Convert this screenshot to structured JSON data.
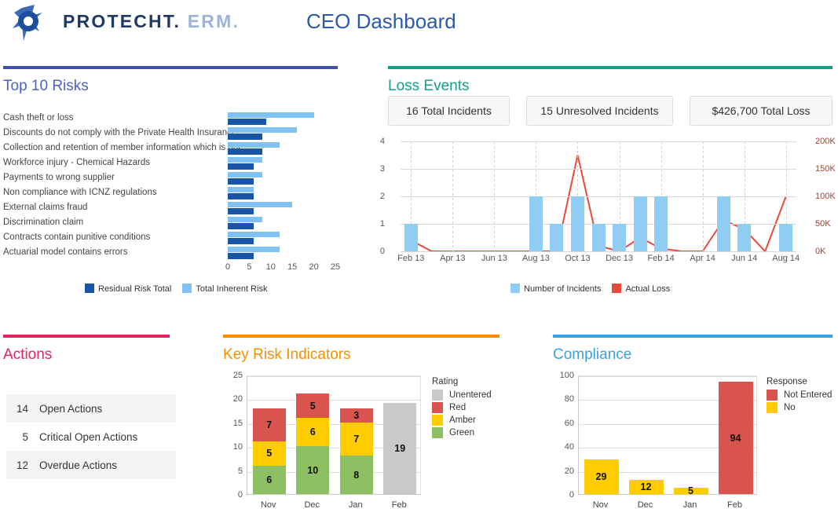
{
  "header": {
    "brand_primary": "PROTECHT.",
    "brand_secondary": "ERM.",
    "title": "CEO Dashboard",
    "logo_icon": "protecht-logo-icon"
  },
  "colors": {
    "risk_accent": "#3f51a8",
    "loss_accent": "#12a08a",
    "actions_accent": "#e0245e",
    "kri_accent": "#f59000",
    "compliance_accent": "#3aa0e0",
    "residual_risk": "#1a54a6",
    "inherent_risk": "#7ec1f2",
    "incidents_bar": "#8fcdf3",
    "actual_loss_line": "#e8493a",
    "rating_unentered": "#c9c9c9",
    "rating_red": "#d9534f",
    "rating_amber": "#ffcc00",
    "rating_green": "#8dc063"
  },
  "risks": {
    "title": "Top 10 Risks",
    "legend": [
      {
        "label": "Residual Risk Total",
        "color": "#1a54a6"
      },
      {
        "label": "Total Inherent Risk",
        "color": "#7ec1f2"
      }
    ],
    "chart_data": {
      "type": "bar",
      "orientation": "horizontal",
      "title": "Top 10 Risks",
      "xlabel": "",
      "ylabel": "",
      "xlim": [
        0,
        25
      ],
      "xticks": [
        0,
        5,
        10,
        15,
        20,
        25
      ],
      "grid": false,
      "legend_position": "bottom",
      "categories": [
        "Cash theft or loss",
        "Discounts do not comply with the Private Health Insurance",
        "Collection and retention of member information which is not",
        "Workforce injury - Chemical Hazards",
        "Payments to wrong supplier",
        "Non compliance with ICNZ regulations",
        "External claims fraud",
        "Discrimination claim",
        "Contracts contain punitive conditions",
        "Actuarial model contains errors"
      ],
      "series": [
        {
          "name": "Total Inherent Risk",
          "color": "#7ec1f2",
          "values": [
            20,
            16,
            12,
            8,
            8,
            6,
            15,
            8,
            12,
            12
          ]
        },
        {
          "name": "Residual Risk Total",
          "color": "#1a54a6",
          "values": [
            9,
            8,
            8,
            6,
            6,
            6,
            6,
            6,
            6,
            6
          ]
        }
      ]
    }
  },
  "loss": {
    "title": "Loss Events",
    "kpis": [
      {
        "label": "16 Total Incidents"
      },
      {
        "label": "15 Unresolved Incidents"
      },
      {
        "label": "$426,700 Total Loss"
      }
    ],
    "legend": [
      {
        "label": "Number of Incidents",
        "color": "#8fcdf3"
      },
      {
        "label": "Actual Loss",
        "color": "#e8493a"
      }
    ],
    "chart_data": {
      "type": "bar",
      "title": "Loss Events",
      "xlabel": "",
      "ylabel": "Number of Incidents",
      "y2label": "Actual Loss",
      "ylim": [
        0,
        4
      ],
      "yticks": [
        0,
        1,
        2,
        3,
        4
      ],
      "y2lim": [
        0,
        200000
      ],
      "y2ticks": [
        "0K",
        "50K",
        "100K",
        "150K",
        "200K"
      ],
      "grid": true,
      "legend_position": "bottom",
      "x": [
        "Feb 13",
        "Mar 13",
        "Apr 13",
        "May 13",
        "Jun 13",
        "Jul 13",
        "Aug 13",
        "Sep 13",
        "Oct 13",
        "Nov 13",
        "Dec 13",
        "Jan 14",
        "Feb 14",
        "Mar 14",
        "Apr 14",
        "May 14",
        "Jun 14",
        "Jul 14",
        "Aug 14"
      ],
      "xticks_shown": [
        "Feb 13",
        "Apr 13",
        "Jun 13",
        "Aug 13",
        "Oct 13",
        "Dec 13",
        "Feb 14",
        "Apr 14",
        "Jun 14",
        "Aug 14"
      ],
      "series": [
        {
          "name": "Number of Incidents",
          "type": "bar",
          "color": "#8fcdf3",
          "values": [
            1,
            0,
            0,
            0,
            0,
            0,
            2,
            1,
            2,
            1,
            1,
            2,
            2,
            0,
            0,
            2,
            1,
            0,
            1
          ]
        },
        {
          "name": "Actual Loss",
          "type": "line",
          "color": "#e8493a",
          "values": [
            20000,
            0,
            0,
            0,
            0,
            0,
            0,
            0,
            175000,
            10000,
            0,
            25000,
            5000,
            0,
            0,
            57000,
            40000,
            0,
            100000
          ]
        }
      ]
    }
  },
  "actions": {
    "title": "Actions",
    "items": [
      {
        "count": "14",
        "label": "Open Actions"
      },
      {
        "count": "5",
        "label": "Critical Open Actions"
      },
      {
        "count": "12",
        "label": "Overdue Actions"
      }
    ]
  },
  "kri": {
    "title": "Key Risk Indicators",
    "legend_title": "Rating",
    "chart_data": {
      "type": "bar",
      "stacked": true,
      "title": "Key Risk Indicators",
      "xlabel": "",
      "ylabel": "",
      "ylim": [
        0,
        25
      ],
      "yticks": [
        0,
        5,
        10,
        15,
        20,
        25
      ],
      "grid": true,
      "legend_position": "right",
      "categories": [
        "Nov",
        "Dec",
        "Jan",
        "Feb"
      ],
      "series": [
        {
          "name": "Unentered",
          "color": "#c9c9c9",
          "values": [
            0,
            0,
            0,
            19
          ]
        },
        {
          "name": "Red",
          "color": "#d9534f",
          "values": [
            7,
            5,
            3,
            0
          ]
        },
        {
          "name": "Amber",
          "color": "#ffcc00",
          "values": [
            5,
            6,
            7,
            0
          ]
        },
        {
          "name": "Green",
          "color": "#8dc063",
          "values": [
            6,
            10,
            8,
            0
          ]
        }
      ],
      "totals": [
        18,
        21,
        18,
        19
      ]
    }
  },
  "compliance": {
    "title": "Compliance",
    "legend_title": "Response",
    "chart_data": {
      "type": "bar",
      "stacked": true,
      "title": "Compliance",
      "xlabel": "",
      "ylabel": "",
      "ylim": [
        0,
        100
      ],
      "yticks": [
        0,
        20,
        40,
        60,
        80,
        100
      ],
      "grid": true,
      "legend_position": "right",
      "categories": [
        "Nov",
        "Dec",
        "Jan",
        "Feb"
      ],
      "series": [
        {
          "name": "Not Entered",
          "color": "#d9534f",
          "values": [
            0,
            0,
            0,
            94
          ]
        },
        {
          "name": "No",
          "color": "#ffcc00",
          "values": [
            29,
            12,
            5,
            0
          ]
        }
      ]
    }
  }
}
